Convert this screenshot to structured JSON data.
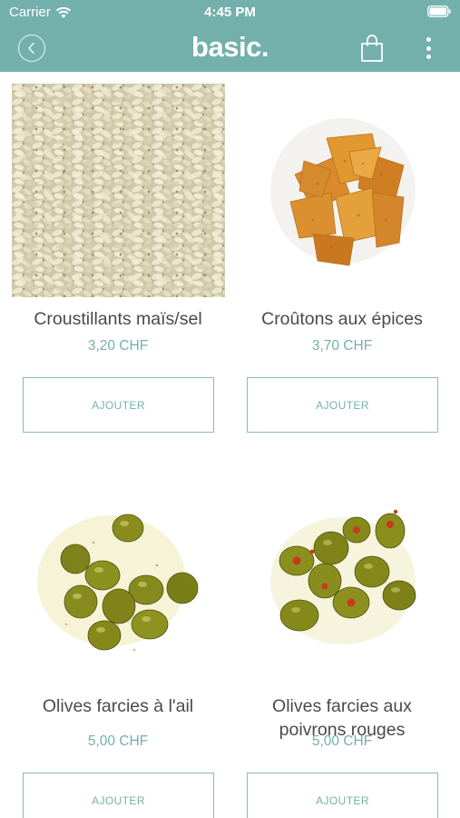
{
  "status_bar": {
    "carrier": "Carrier",
    "time": "4:45 PM"
  },
  "nav": {
    "logo": "basic."
  },
  "products": [
    {
      "name": "Croustillants maïs/sel",
      "price": "3,20 CHF",
      "button": "AJOUTER",
      "image": "corn-puffs"
    },
    {
      "name": "Croûtons aux épices",
      "price": "3,70 CHF",
      "button": "AJOUTER",
      "image": "spiced-croutons"
    },
    {
      "name": "Olives farcies à l'ail",
      "price": "5,00 CHF",
      "button": "AJOUTER",
      "image": "garlic-olives"
    },
    {
      "name_lines": [
        "Olives farcies aux",
        "poivrons rouges"
      ],
      "price": "5,00 CHF",
      "button": "AJOUTER",
      "image": "pepper-olives"
    }
  ],
  "colors": {
    "header": "#73b0ac",
    "accent": "#73b0ac",
    "text": "#4a4a4a"
  }
}
